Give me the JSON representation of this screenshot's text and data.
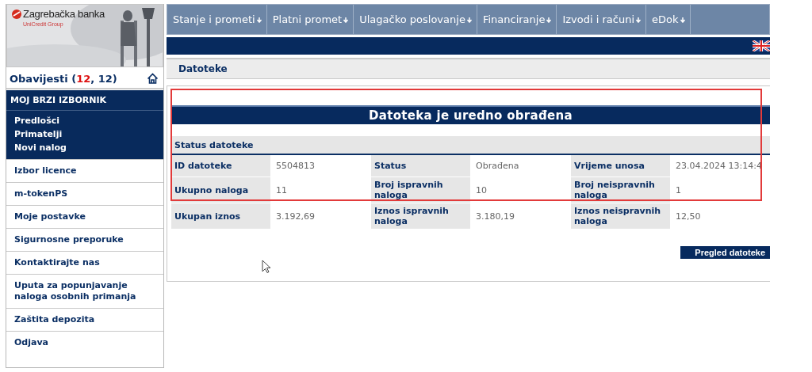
{
  "logo": {
    "name": "Zagrebačka banka",
    "group": "UniCredit Group"
  },
  "notifications": {
    "prefix": "Obavijesti (",
    "highlight": "12",
    "suffix": ", 12)"
  },
  "quick_menu": {
    "title": "MOJ BRZI IZBORNIK",
    "items": [
      "Predlošci",
      "Primatelji",
      "Novi nalog"
    ]
  },
  "side_items": [
    "Izbor licence",
    "m-tokenPS",
    "Moje postavke",
    "Sigurnosne preporuke",
    "Kontaktirajte nas",
    "Uputa za popunjavanje naloga osobnih primanja",
    "Zaštita depozita",
    "Odjava"
  ],
  "nav": [
    "Stanje i prometi",
    "Platni promet",
    "Ulagačko poslovanje",
    "Financiranje",
    "Izvodi i računi",
    "eDok"
  ],
  "section_title": "Datoteke",
  "result_title": "Datoteka je uredno obrađena",
  "status_header": "Status datoteke",
  "rows": [
    [
      {
        "label": "ID datoteke",
        "value": "5504813"
      },
      {
        "label": "Status",
        "value": "Obrađena"
      },
      {
        "label": "Vrijeme unosa",
        "value": "23.04.2024 13:14:4"
      }
    ],
    [
      {
        "label": "Ukupno naloga",
        "value": "11"
      },
      {
        "label": "Broj ispravnih naloga",
        "value": "10"
      },
      {
        "label": "Broj neispravnih naloga",
        "value": "1"
      }
    ],
    [
      {
        "label": "Ukupan iznos",
        "value": "3.192,69"
      },
      {
        "label": "Iznos ispravnih naloga",
        "value": "3.180,19"
      },
      {
        "label": "Iznos neispravnih naloga",
        "value": "12,50"
      }
    ]
  ],
  "button": "Pregled datoteke"
}
